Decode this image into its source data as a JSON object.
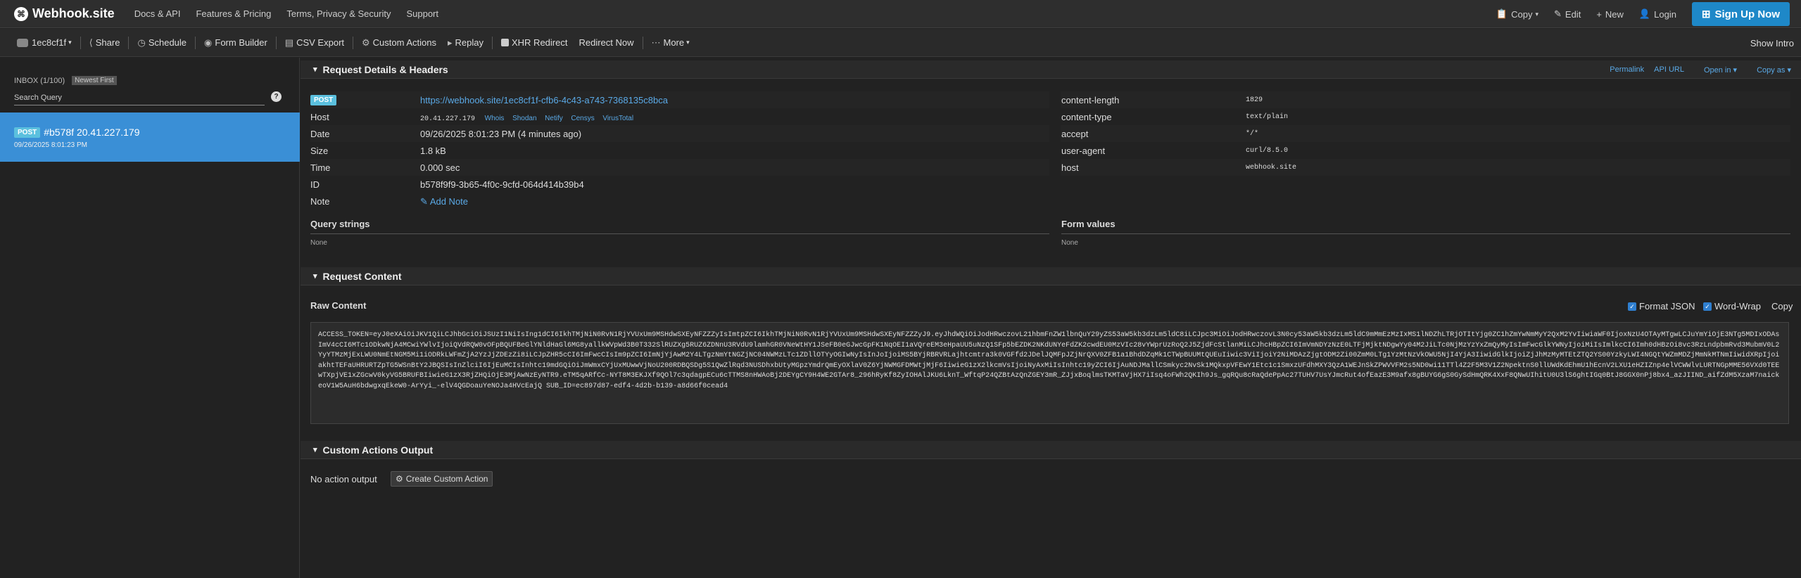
{
  "nav": {
    "brand": "Webhook.site",
    "links": [
      "Docs & API",
      "Features & Pricing",
      "Terms, Privacy & Security",
      "Support"
    ],
    "copy": "Copy",
    "edit": "Edit",
    "new": "New",
    "login": "Login",
    "signup": "Sign Up Now"
  },
  "toolbar": {
    "token": "1ec8cf1f",
    "share": "Share",
    "schedule": "Schedule",
    "form_builder": "Form Builder",
    "csv_export": "CSV Export",
    "custom_actions": "Custom Actions",
    "replay": "Replay",
    "xhr_redirect": "XHR Redirect",
    "redirect_now": "Redirect Now",
    "more": "More",
    "show_intro": "Show Intro"
  },
  "sidebar": {
    "inbox": "INBOX (1/100)",
    "sort": "Newest First",
    "search_placeholder": "Search Query",
    "requests": [
      {
        "method": "POST",
        "label": "#b578f 20.41.227.179",
        "time": "09/26/2025 8:01:23 PM"
      }
    ]
  },
  "details": {
    "title": "Request Details & Headers",
    "links": [
      "Permalink",
      "API URL",
      "Open in",
      "Copy as"
    ],
    "method": "POST",
    "url": "https://webhook.site/1ec8cf1f-cfb6-4c43-a743-7368135c8bca",
    "host_label": "Host",
    "host_ip": "20.41.227.179",
    "host_tools": [
      "Whois",
      "Shodan",
      "Netify",
      "Censys",
      "VirusTotal"
    ],
    "date_label": "Date",
    "date": "09/26/2025 8:01:23 PM (4 minutes ago)",
    "size_label": "Size",
    "size": "1.8 kB",
    "time_label": "Time",
    "time": "0.000 sec",
    "id_label": "ID",
    "id": "b578f9f9-3b65-4f0c-9cfd-064d414b39b4",
    "note_label": "Note",
    "add_note": "Add Note",
    "headers": [
      {
        "k": "content-length",
        "v": "1829"
      },
      {
        "k": "content-type",
        "v": "text/plain"
      },
      {
        "k": "accept",
        "v": "*/*"
      },
      {
        "k": "user-agent",
        "v": "curl/8.5.0"
      },
      {
        "k": "host",
        "v": "webhook.site"
      }
    ],
    "query_title": "Query strings",
    "query_none": "None",
    "form_title": "Form values",
    "form_none": "None"
  },
  "content": {
    "title": "Request Content",
    "raw_title": "Raw Content",
    "format_json": "Format JSON",
    "word_wrap": "Word-Wrap",
    "copy": "Copy",
    "raw": "ACCESS_TOKEN=eyJ0eXAiOiJKV1QiLCJhbGciOiJSUzI1NiIsIng1dCI6IkhTMjNiN0RvN1RjYVUxUm9MSHdwSXEyNFZZZyIsImtpZCI6IkhTMjNiN0RvN1RjYVUxUm9MSHdwSXEyNFZZZyJ9.eyJhdWQiOiJodHRwczovL21hbmFnZW1lbnQuY29yZS53aW5kb3dzLm5ldC8iLCJpc3MiOiJodHRwczovL3N0cy53aW5kb3dzLm5ldC9mMmEzMzIxMS1lNDZhLTRjOTItYjg0ZC1hZmYwNmMyY2QxM2YvIiwiaWF0IjoxNzU4OTAyMTgwLCJuYmYiOjE3NTg5MDIxODAsImV4cCI6MTc1ODkwNjA4MCwiYWlvIjoiQVdRQW0vOFpBQUFBeGlYNldHaGl6MG8yallkWVpWd3B0T332SlRUZXg5RUZ6ZDNnU3RVdU9lamhGR0VNeWtHY1JSeFB0eGJwcGpFK1NqOEI1aVQreEM3eHpaUU5uNzQ1SFp5bEZDK2NKdUNYeFdZK2cwdEU0MzVIc28vYWprUzRoQ2J5ZjdFcStlanMiLCJhcHBpZCI6ImVmNDYzNzE0LTFjMjktNDgwYy04M2JiLTc0NjMzYzYxZmQyMyIsImFwcGlkYWNyIjoiMiIsImlkcCI6Imh0dHBzOi8vc3RzLndpbmRvd3MubmV0L2YyYTMzMjExLWU0NmEtNGM5Mi1iODRkLWFmZjA2YzJjZDEzZi8iLCJpZHR5cCI6ImFwcCIsIm9pZCI6ImNjYjAwM2Y4LTgzNmYtNGZjNC04NWMzLTc1ZDllOTYyOGIwNyIsInJoIjoiMS5BYjRBRVRLajhtcmtra3k0VGFfd2JDelJQMFpJZjNrQXV0ZFB1a1BhdDZqMk1CTWpBUUMtQUEuIiwic3ViIjoiY2NiMDAzZjgtODM2Zi00ZmM0LTg1YzMtNzVkOWU5NjI4YjA3IiwidGlkIjoiZjJhMzMyMTEtZTQ2YS00YzkyLWI4NGQtYWZmMDZjMmNkMTNmIiwidXRpIjoiakhtTEFaUHRURTZpTG5WSnBtY2JBQSIsInZlciI6IjEuMCIsInhtc19mdGQiOiJmWmxCYjUxMUwwVjNoU200RDBQSDg5S1QwZlRqd3NUSDhxbUtyMGpzYmdrQmEyOXlaV0Z6YjNWMGFDMWtjMjF6IiwieG1zX2lkcmVsIjoiNyAxMiIsInhtc19yZCI6IjAuNDJMallCSmkyc2NvSk1MQkxpVFEwY1Etc1c1SmxzUFdhMXY3QzA1WEJnSkZPWVVFM2s5ND0wi11TTl4Z2F5M3V1Z2NpektnS0llUWdKdEhmU1hEcnV2LXU1eHZIZnp4elVCWWlvLURTNGpMME56VXd0TEEwTXpjVE1xZGcwV0kyVG5BRUFBIiwieG1zX3RjZHQiOjE3MjAwNzEyNTR9.eTM5qARfCc-NYT8M3EKJXf9QOl7c3qdagpECu6cTTMS8nHWAoBj2DEYgCY9H4WE2GTAr8_296hRyKf8ZyIOHAlJKU6LknT_WftqP24QZBtAzQnZGEY3mR_ZJjxBoqlmsTKMTaVjHX7iIsq4oFWh2QKIh9Js_gqRQu8cRaQdePpAc27TUHV7UsYJmcRut4ofEazE3M9afx8gBUYG6gS0GySdHmQRK4XxF8QNwUIhitU0U3lS6ghtIGq0BtJ8GGX0nPj8bx4_azJIIND_aifZdM5XzaM7naickeoV1W5AuH6bdwgxqEkeW0-ArYyi_-elV4QGDoauYeNOJa4HVcEajQ SUB_ID=ec897d87-edf4-4d2b-b139-a8d66f0cead4"
  },
  "custom_actions": {
    "title": "Custom Actions Output",
    "no_output": "No action output",
    "create": "Create Custom Action"
  },
  "colors": {
    "accent": "#1e88c8",
    "selected": "#3a8fd6",
    "link": "#5aa9e6",
    "badge": "#5bc0de"
  }
}
